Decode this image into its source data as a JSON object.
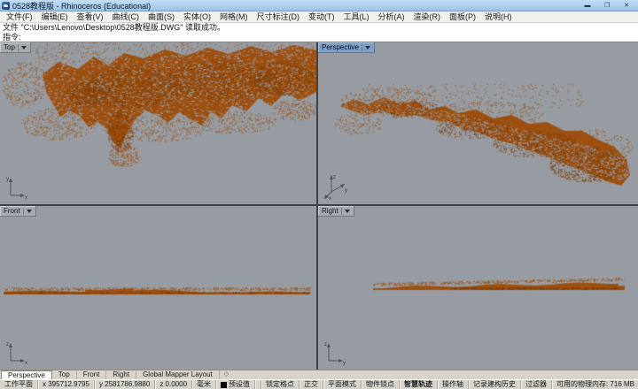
{
  "window": {
    "title": "0528教程版 - Rhinoceros (Educational)"
  },
  "window_controls": {
    "minimize": "▬",
    "maximize": "❐",
    "close": "✕"
  },
  "menu": {
    "items": [
      "文件(F)",
      "编辑(E)",
      "查看(V)",
      "曲线(C)",
      "曲面(S)",
      "实体(O)",
      "网格(M)",
      "尺寸标注(D)",
      "变动(T)",
      "工具(L)",
      "分析(A)",
      "渲染(R)",
      "面板(P)",
      "说明(H)"
    ]
  },
  "command": {
    "history": "文件 \"C:\\Users\\Lenovo\\Desktop\\0528教程版.DWG\" 读取成功。",
    "prompt": "指令:"
  },
  "viewports": {
    "top": {
      "label": "Top",
      "axis_h": "x",
      "axis_v": "y"
    },
    "perspective": {
      "label": "Perspective",
      "axis_up": "z",
      "axis_right": "y",
      "axis_left": "x"
    },
    "front": {
      "label": "Front",
      "axis_h": "x",
      "axis_v": "z"
    },
    "right": {
      "label": "Right",
      "axis_h": "y",
      "axis_v": "z"
    }
  },
  "bottom_tabs": {
    "tabs": [
      "Perspective",
      "Top",
      "Front",
      "Right",
      "Global Mapper Layout"
    ],
    "nav_icon": "◇"
  },
  "statusbar": {
    "cplane": "工作平面",
    "coord_x": "x 395712.9795",
    "coord_y": "y 2581786.9880",
    "coord_z": "z 0.0000",
    "units": "毫米",
    "layer": "预设值",
    "toggles": [
      "锁定格点",
      "正交",
      "平面模式",
      "物件锁点",
      "智慧轨迹",
      "操作轴",
      "记录建构历史",
      "过滤器"
    ],
    "memory": "可用的物理内存: 716 MB"
  },
  "colors": {
    "pointcloud": "#9E5010",
    "pointcloud_dark": "#7C3E0A",
    "viewport_bg": "#979CA3",
    "active_tab": "#7E9EC5",
    "titlebar": "#A9CBEC"
  }
}
